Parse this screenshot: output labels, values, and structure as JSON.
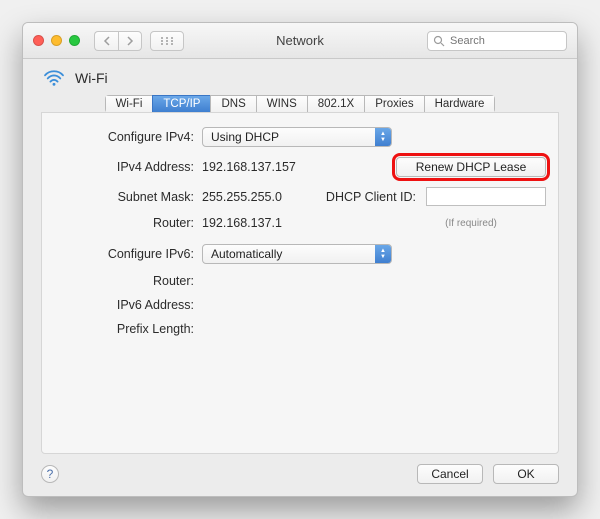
{
  "window": {
    "title": "Network",
    "search_placeholder": "Search"
  },
  "header": {
    "interface_name": "Wi-Fi"
  },
  "tabs": [
    "Wi-Fi",
    "TCP/IP",
    "DNS",
    "WINS",
    "802.1X",
    "Proxies",
    "Hardware"
  ],
  "active_tab_index": 1,
  "ipv4": {
    "configure_label": "Configure IPv4:",
    "configure_value": "Using DHCP",
    "address_label": "IPv4 Address:",
    "address_value": "192.168.137.157",
    "subnet_label": "Subnet Mask:",
    "subnet_value": "255.255.255.0",
    "router_label": "Router:",
    "router_value": "192.168.137.1",
    "renew_label": "Renew DHCP Lease",
    "dhcp_client_label": "DHCP Client ID:",
    "dhcp_client_value": "",
    "dhcp_client_helper": "(If required)"
  },
  "ipv6": {
    "configure_label": "Configure IPv6:",
    "configure_value": "Automatically",
    "router_label": "Router:",
    "router_value": "",
    "address_label": "IPv6 Address:",
    "address_value": "",
    "prefix_label": "Prefix Length:",
    "prefix_value": ""
  },
  "footer": {
    "cancel": "Cancel",
    "ok": "OK"
  }
}
